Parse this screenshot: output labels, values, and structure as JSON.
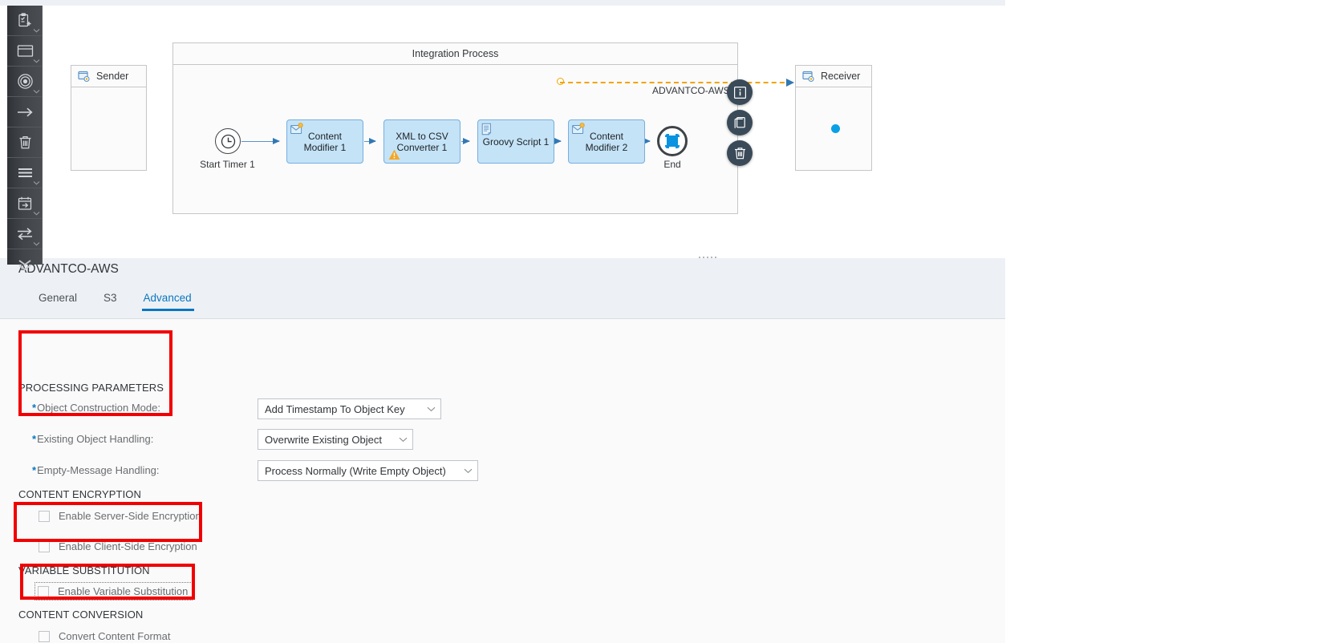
{
  "palette": {
    "items": [
      {
        "name": "add-process-icon",
        "label": "Process",
        "has_caret": true
      },
      {
        "name": "pool-icon",
        "label": "Participant",
        "has_caret": true
      },
      {
        "name": "events-icon",
        "label": "Events",
        "has_caret": true
      },
      {
        "name": "arrow-right-icon",
        "label": "Connector",
        "has_caret": false
      },
      {
        "name": "trash-icon",
        "label": "Delete",
        "has_caret": false
      },
      {
        "name": "menu-lines-icon",
        "label": "Message Transformers",
        "has_caret": true
      },
      {
        "name": "calendar-arrow-icon",
        "label": "Call Activity",
        "has_caret": true
      },
      {
        "name": "exchange-arrows-icon",
        "label": "Message Routing",
        "has_caret": true
      },
      {
        "name": "chevrons-down-icon",
        "label": "More",
        "has_caret": false
      }
    ]
  },
  "canvas": {
    "sender_pool": {
      "title": "Sender",
      "icon": "sender-participant-icon"
    },
    "receiver_pool": {
      "title": "Receiver",
      "icon": "receiver-participant-icon"
    },
    "process_pool": {
      "title": "Integration Process"
    },
    "start_event": {
      "label": "Start Timer 1",
      "icon": "timer-clock-icon"
    },
    "end_event": {
      "label": "End",
      "icon": "end-event-selected-icon"
    },
    "nodes": [
      {
        "label": "Content\nModifier 1",
        "line1": "Content",
        "line2": "Modifier 1",
        "icon": "content-modifier-icon",
        "warning": false
      },
      {
        "label": "XML to CSV\nConverter 1",
        "line1": "XML to CSV",
        "line2": "Converter 1",
        "icon": "",
        "warning": true
      },
      {
        "label": "Groovy Script 1",
        "line1": "Groovy Script 1",
        "line2": "",
        "icon": "script-icon",
        "warning": false
      },
      {
        "label": "Content\nModifier 2",
        "line1": "Content",
        "line2": "Modifier 2",
        "icon": "content-modifier-icon",
        "warning": false
      }
    ],
    "message_flow_label": "ADVANTCO-AWS",
    "fab_buttons": [
      {
        "name": "info-button",
        "icon": "info-icon"
      },
      {
        "name": "copy-button",
        "icon": "copy-icon"
      },
      {
        "name": "delete-button",
        "icon": "trash-icon"
      }
    ]
  },
  "properties": {
    "title": "ADVANTCO-AWS",
    "tabs": [
      {
        "label": "General",
        "active": false
      },
      {
        "label": "S3",
        "active": false
      },
      {
        "label": "Advanced",
        "active": true
      }
    ],
    "sections": {
      "processing": {
        "title": "PROCESSING PARAMETERS"
      },
      "encryption": {
        "title": "CONTENT ENCRYPTION"
      },
      "variable": {
        "title": "VARIABLE SUBSTITUTION"
      },
      "conversion": {
        "title": "CONTENT CONVERSION"
      }
    },
    "fields": [
      {
        "label": "Object Construction Mode:",
        "required": true,
        "value": "Add Timestamp To Object Key"
      },
      {
        "label": "Existing Object Handling:",
        "required": true,
        "value": "Overwrite Existing Object"
      },
      {
        "label": "Empty-Message Handling:",
        "required": true,
        "value": "Process Normally (Write Empty Object)"
      }
    ],
    "checkboxes": [
      {
        "label": "Enable Server-Side Encryption",
        "checked": false,
        "focused": false
      },
      {
        "label": "Enable Client-Side Encryption",
        "checked": false,
        "focused": false
      },
      {
        "label": "Enable Variable Substitution",
        "checked": false,
        "focused": true
      },
      {
        "label": "Convert Content Format",
        "checked": false,
        "focused": false
      }
    ]
  },
  "colors": {
    "accent": "#0a76bf",
    "annotation": "#f00000",
    "node_fill": "#c5e3f7",
    "node_border": "#76aede",
    "message_flow": "#f0a500",
    "panel_header": "#edf1f5"
  }
}
